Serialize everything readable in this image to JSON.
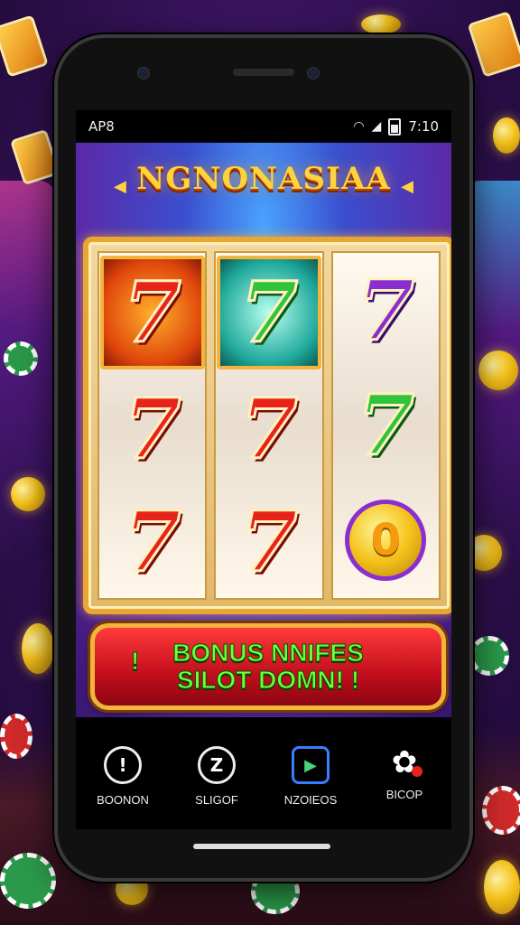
{
  "status_bar": {
    "left_label": "AP8",
    "time": "7:10",
    "wifi_icon": "wifi-icon",
    "signal_icon": "signal-icon",
    "battery_icon": "battery-icon"
  },
  "game": {
    "title": "NGNONASIAA",
    "reels": [
      [
        "7",
        "7",
        "7"
      ],
      [
        "7",
        "7",
        "7"
      ],
      [
        "7",
        "7",
        "0"
      ]
    ],
    "banner": {
      "line1": "BONUS NNIFES",
      "line2": "SILOT DOMN! !",
      "icon": "exclamation-icon"
    }
  },
  "bottom_nav": [
    {
      "label": "BOONON",
      "icon": "info-icon",
      "glyph": "!"
    },
    {
      "label": "SLIGOF",
      "icon": "z-icon",
      "glyph": "Z"
    },
    {
      "label": "NZOIEOS",
      "icon": "play-store-icon",
      "glyph": "▶"
    },
    {
      "label": "BICOP",
      "icon": "gear-icon",
      "glyph": "✿"
    }
  ],
  "colors": {
    "title": "#ffd43a",
    "banner_text": "#6fff3a",
    "frame": "#e9a631"
  }
}
